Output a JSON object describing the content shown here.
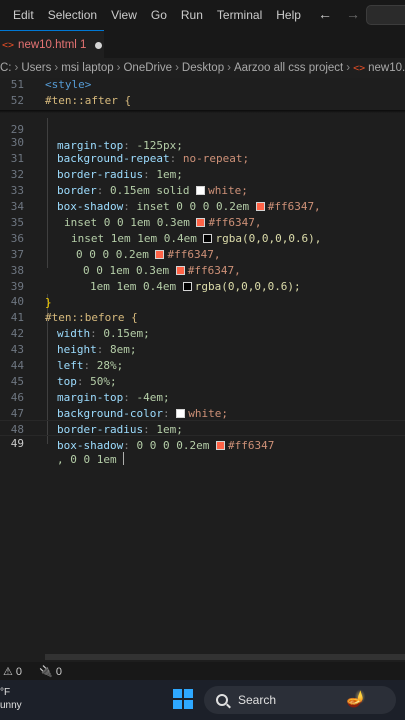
{
  "menu": [
    "Edit",
    "Selection",
    "View",
    "Go",
    "Run",
    "Terminal",
    "Help"
  ],
  "nav": {
    "back_icon": "arrow-left-icon",
    "forward_icon": "arrow-right-icon"
  },
  "tab": {
    "label": "new10.html 1"
  },
  "breadcrumb": [
    "C:",
    "Users",
    "msi laptop",
    "OneDrive",
    "Desktop",
    "Aarzoo all css project",
    "new10."
  ],
  "sticky": [
    {
      "ln": "51",
      "text": "<style>"
    },
    {
      "ln": "52",
      "text": "#ten::after {"
    }
  ],
  "lines": {
    "l29": {
      "ln": "29",
      "p": "margin-top",
      "v": "-125px;"
    },
    "l30": {
      "ln": "30",
      "p": "background-repeat",
      "v": "no-repeat;"
    },
    "l31": {
      "ln": "31",
      "p": "border-radius",
      "v": "1em;"
    },
    "l32": {
      "ln": "32",
      "p": "border",
      "v": "0.15em solid",
      "c": "white;"
    },
    "l33": {
      "ln": "33",
      "p": "box-shadow",
      "v": "inset 0 0 0 0.2em",
      "c": "#ff6347,"
    },
    "l34": {
      "ln": "34",
      "v": "inset 0 0 1em 0.3em",
      "c": "#ff6347,"
    },
    "l35": {
      "ln": "35",
      "v": "inset 1em 1em 0.4em",
      "c": "rgba(0,0,0,0.6),"
    },
    "l36": {
      "ln": "36",
      "v": "0 0 0 0.2em",
      "c": "#ff6347,"
    },
    "l37": {
      "ln": "37",
      "v": "0 0 1em 0.3em",
      "c": "#ff6347,"
    },
    "l38": {
      "ln": "38",
      "v": "1em 1em 0.4em",
      "c": "rgba(0,0,0,0.6);"
    },
    "l39": {
      "ln": "39",
      "t": "}"
    },
    "l40": {
      "ln": "40",
      "t": "#ten::before {"
    },
    "l41": {
      "ln": "41",
      "p": "width",
      "v": "0.15em;"
    },
    "l42": {
      "ln": "42",
      "p": "height",
      "v": "8em;"
    },
    "l43": {
      "ln": "43",
      "p": "left",
      "v": "28%;"
    },
    "l44": {
      "ln": "44",
      "p": "top",
      "v": "50%;"
    },
    "l45": {
      "ln": "45",
      "p": "margin-top",
      "v": "-4em;"
    },
    "l46": {
      "ln": "46",
      "p": "background-color",
      "c": "white;"
    },
    "l47": {
      "ln": "47",
      "p": "border-radius",
      "v": "1em;"
    },
    "l48": {
      "ln": "48",
      "p": "box-shadow",
      "v": "0 0 0 0.2em",
      "c": "#ff6347"
    },
    "l49": {
      "ln": "49",
      "t": ", 0 0 1em "
    }
  },
  "colors": {
    "tomato": "#ff6347",
    "white": "#ffffff",
    "shadow": "#000000"
  },
  "status": {
    "errors": "0",
    "ports": "0"
  },
  "taskbar": {
    "weather": "°F",
    "weather_desc": "unny",
    "search_label": "Search"
  }
}
